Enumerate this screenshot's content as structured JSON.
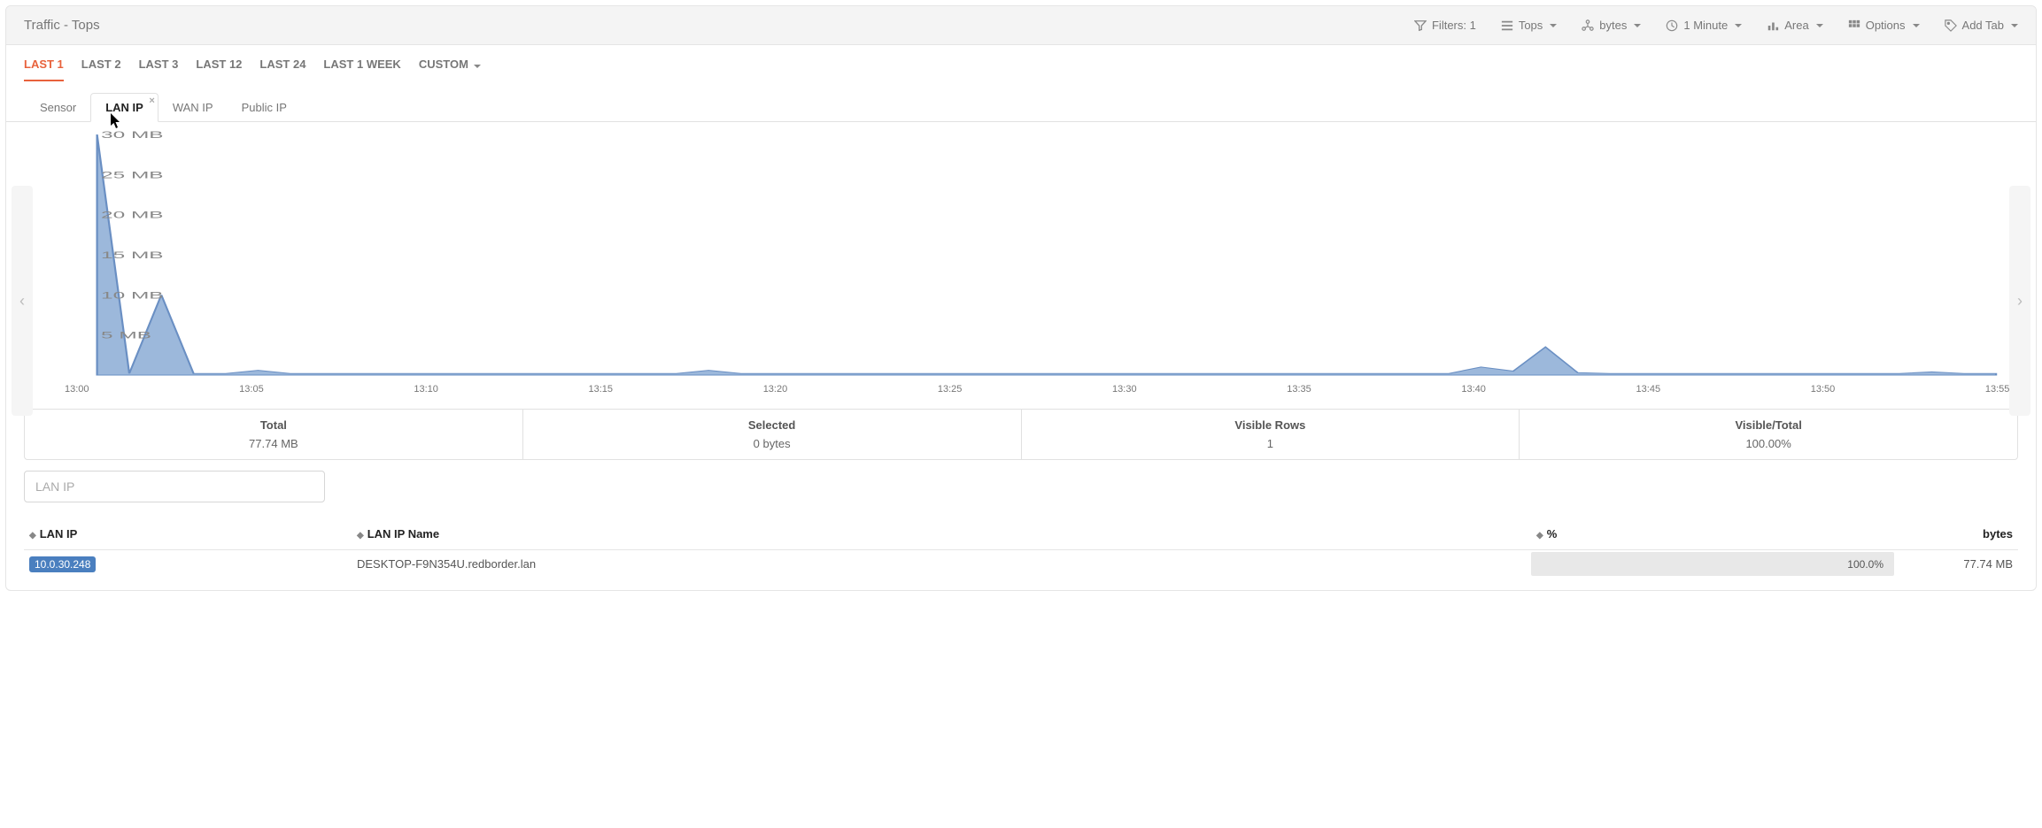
{
  "header": {
    "page_title": "Traffic - Tops",
    "filters_label": "Filters: 1",
    "tops_label": "Tops",
    "bytes_label": "bytes",
    "minute_label": "1 Minute",
    "area_label": "Area",
    "options_label": "Options",
    "add_tab_label": "Add Tab"
  },
  "period_tabs": [
    {
      "label": "LAST 1",
      "active": true
    },
    {
      "label": "LAST 2"
    },
    {
      "label": "LAST 3"
    },
    {
      "label": "LAST 12"
    },
    {
      "label": "LAST 24"
    },
    {
      "label": "LAST 1 WEEK"
    },
    {
      "label": "CUSTOM",
      "dropdown": true
    }
  ],
  "sub_tabs": [
    {
      "label": "Sensor"
    },
    {
      "label": "LAN IP",
      "active": true,
      "closable": true
    },
    {
      "label": "WAN IP"
    },
    {
      "label": "Public IP"
    }
  ],
  "chart_data": {
    "type": "area",
    "ylabel_unit": "MB",
    "ylim_max": 30,
    "y_ticks": [
      "30 MB",
      "25 MB",
      "20 MB",
      "15 MB",
      "10 MB",
      "5 MB"
    ],
    "x_ticks": [
      "13:00",
      "13:05",
      "13:10",
      "13:15",
      "13:20",
      "13:25",
      "13:30",
      "13:35",
      "13:40",
      "13:45",
      "13:50",
      "13:55"
    ],
    "x": [
      0,
      1,
      2,
      3,
      4,
      5,
      6,
      7,
      8,
      9,
      10,
      11,
      12,
      13,
      14,
      15,
      16,
      17,
      18,
      19,
      20,
      21,
      22,
      23,
      24,
      25,
      26,
      27,
      28,
      29,
      30,
      31,
      32,
      33,
      34,
      35,
      36,
      37,
      38,
      39,
      40,
      41,
      42,
      43,
      44,
      45,
      46,
      47,
      48,
      49,
      50,
      51,
      52,
      53,
      54,
      55,
      56,
      57,
      58,
      59
    ],
    "values_mb": [
      32,
      0.2,
      10,
      0.2,
      0.2,
      0.6,
      0.2,
      0.2,
      0.2,
      0.2,
      0.2,
      0.2,
      0.2,
      0.2,
      0.2,
      0.2,
      0.2,
      0.2,
      0.2,
      0.6,
      0.2,
      0.2,
      0.2,
      0.2,
      0.2,
      0.2,
      0.2,
      0.2,
      0.2,
      0.2,
      0.2,
      0.2,
      0.2,
      0.2,
      0.2,
      0.2,
      0.2,
      0.2,
      0.2,
      0.2,
      0.2,
      0.2,
      0.2,
      1.0,
      0.5,
      3.5,
      0.3,
      0.2,
      0.2,
      0.2,
      0.2,
      0.2,
      0.2,
      0.2,
      0.2,
      0.2,
      0.2,
      0.4,
      0.2,
      0.2
    ],
    "series_color": "#9cb8db",
    "series_stroke": "#6a8fc3"
  },
  "summary": {
    "total_label": "Total",
    "total_value": "77.74 MB",
    "selected_label": "Selected",
    "selected_value": "0 bytes",
    "visible_rows_label": "Visible Rows",
    "visible_rows_value": "1",
    "visible_total_label": "Visible/Total",
    "visible_total_value": "100.00%"
  },
  "search": {
    "placeholder": "LAN IP"
  },
  "table": {
    "columns": {
      "lan_ip": "LAN IP",
      "lan_ip_name": "LAN IP Name",
      "percent": "%",
      "bytes": "bytes"
    },
    "rows": [
      {
        "lan_ip": "10.0.30.248",
        "lan_ip_name": "DESKTOP-F9N354U.redborder.lan",
        "percent_text": "100.0%",
        "percent_value": 100.0,
        "bytes": "77.74 MB"
      }
    ]
  }
}
